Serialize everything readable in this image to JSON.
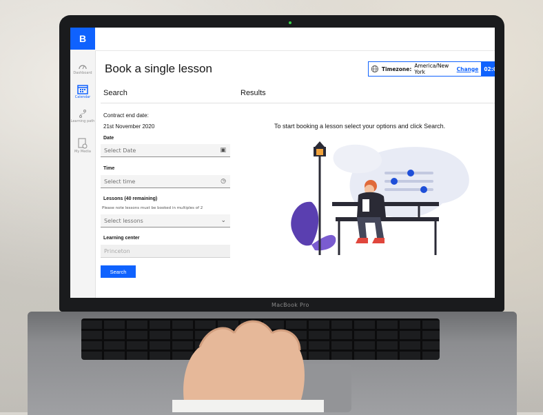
{
  "app": {
    "logo_letter": "B",
    "page_title": "Book a single lesson",
    "accent": "#0f62fe"
  },
  "sidebar": {
    "items": [
      {
        "label": "Dashboard",
        "icon": "dashboard-icon"
      },
      {
        "label": "Calendar",
        "icon": "calendar-icon",
        "active": true
      },
      {
        "label": "Learning path",
        "icon": "learning-path-icon"
      },
      {
        "label": "My Media",
        "icon": "media-icon"
      }
    ]
  },
  "timezone": {
    "label": "Timezone:",
    "value": "America/New York",
    "change_link": "Change",
    "time": "02:0"
  },
  "search": {
    "heading": "Search",
    "contract_label": "Contract end date:",
    "contract_value": "21st November 2020",
    "date_label": "Date",
    "date_placeholder": "Select Date",
    "time_label": "Time",
    "time_placeholder": "Select time",
    "lessons_label": "Lessons (40 remaining)",
    "lessons_note": "Please note lessons must be booked in multiples of 2",
    "lessons_placeholder": "Select lessons",
    "center_label": "Learning center",
    "center_value": "Princeton",
    "button": "Search"
  },
  "results": {
    "heading": "Results",
    "prompt": "To start booking a lesson select your options and click Search."
  },
  "device": {
    "brand": "MacBook Pro"
  }
}
